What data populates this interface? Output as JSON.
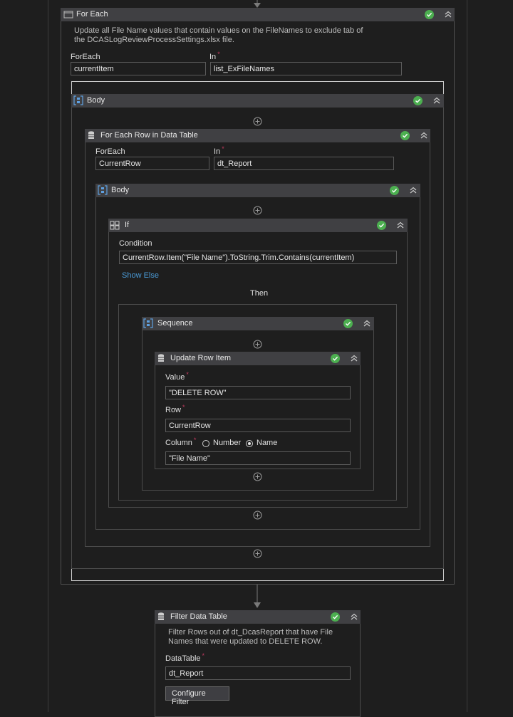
{
  "colors": {
    "background": "#1e1e1e",
    "header": "#404043",
    "success": "#4caf50",
    "link": "#4a9ad6",
    "required": "#c23a5f"
  },
  "foreach": {
    "title": "For Each",
    "description": "Update all File Name values that contain values on the FileNames to exclude tab of the DCASLogReviewProcessSettings.xlsx file.",
    "foreach_label": "ForEach",
    "foreach_value": "currentItem",
    "in_label": "In",
    "in_value": "list_ExFileNames",
    "icon": "foreach-icon"
  },
  "body1": {
    "title": "Body",
    "icon": "body-icon"
  },
  "foreach_row": {
    "title": "For Each Row in Data Table",
    "foreach_label": "ForEach",
    "foreach_value": "CurrentRow",
    "in_label": "In",
    "in_value": "dt_Report",
    "icon": "datatable-icon"
  },
  "body2": {
    "title": "Body",
    "icon": "body-icon"
  },
  "if": {
    "title": "If",
    "condition_label": "Condition",
    "condition_value": "CurrentRow.Item(\"File Name\").ToString.Trim.Contains(currentItem)",
    "show_else": "Show Else",
    "then_label": "Then",
    "icon": "if-icon"
  },
  "sequence": {
    "title": "Sequence",
    "icon": "sequence-icon"
  },
  "update_row": {
    "title": "Update Row Item",
    "value_label": "Value",
    "value_value": "\"DELETE ROW\"",
    "row_label": "Row",
    "row_value": "CurrentRow",
    "column_label": "Column",
    "option_number": "Number",
    "option_name": "Name",
    "selected_option": "Name",
    "column_value": "\"File Name\"",
    "icon": "datatable-icon"
  },
  "filter": {
    "title": "Filter Data Table",
    "description": "Filter Rows out of dt_DcasReport that have File Names that were updated to DELETE ROW.",
    "datatable_label": "DataTable",
    "datatable_value": "dt_Report",
    "configure_button": "Configure Filter",
    "icon": "datatable-icon"
  },
  "required_mark": "*"
}
